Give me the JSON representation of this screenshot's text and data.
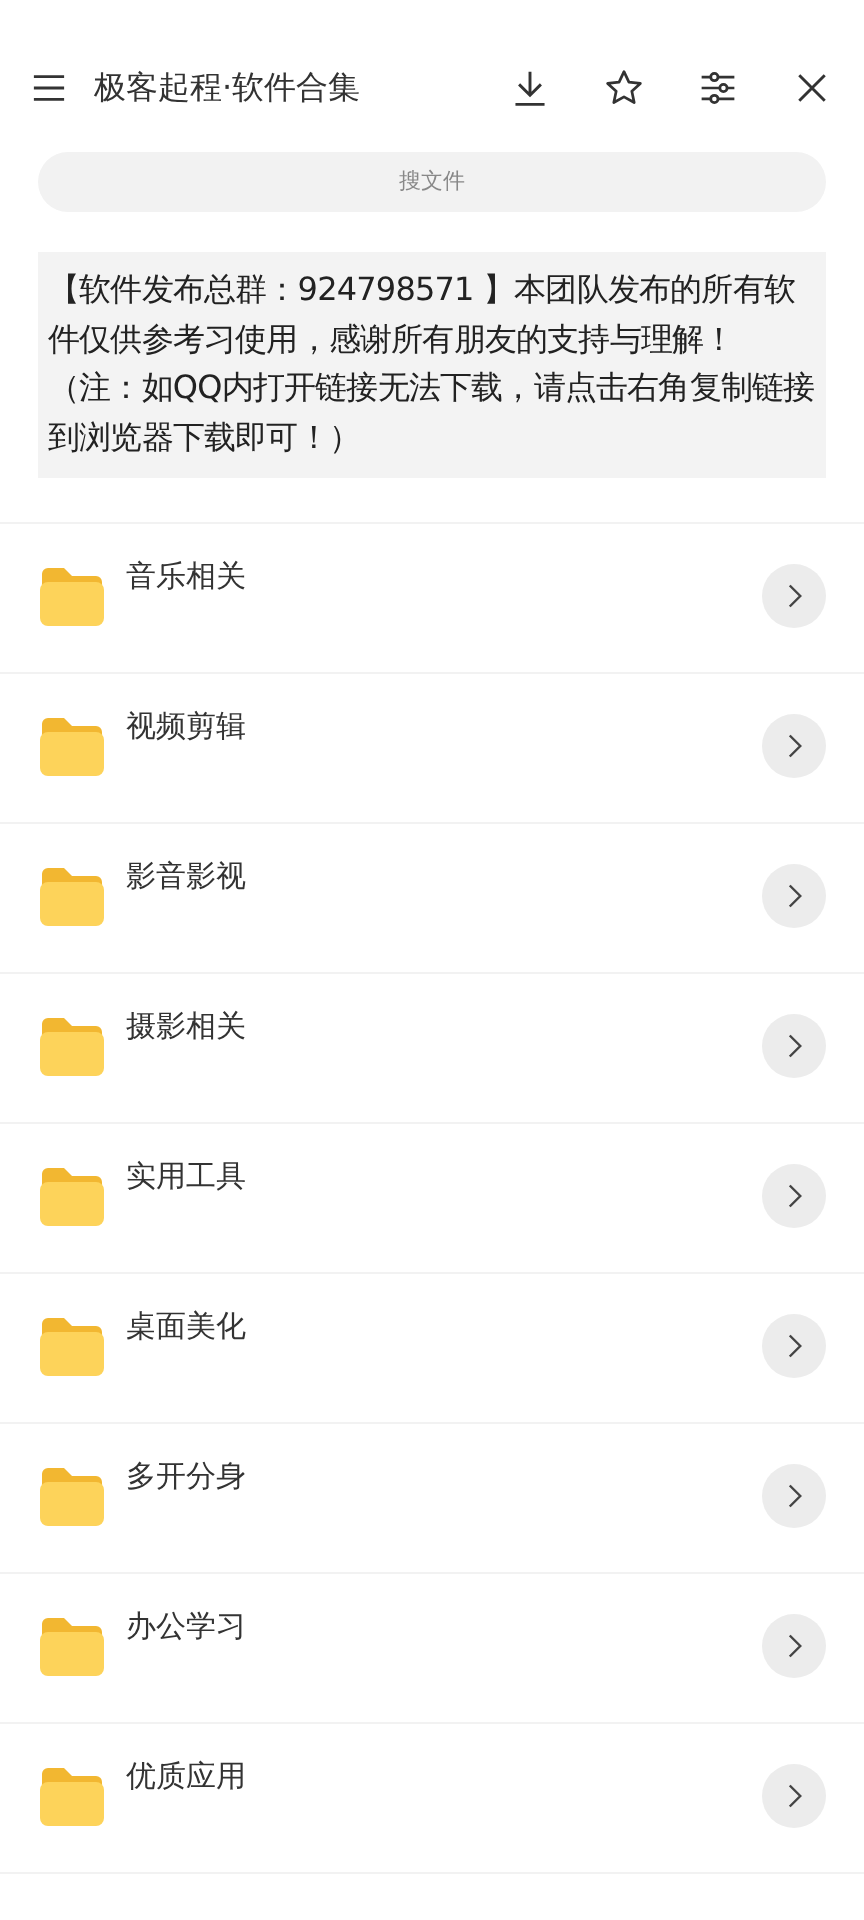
{
  "header": {
    "title": "极客起程·软件合集"
  },
  "search": {
    "placeholder": "搜文件"
  },
  "notice": "【软件发布总群：924798571 】本团队发布的所有软件仅供参考习使用，感谢所有朋友的支持与理解！（注：如QQ内打开链接无法下载，请点击右角复制链接到浏览器下载即可！）",
  "folders": [
    {
      "name": "音乐相关"
    },
    {
      "name": "视频剪辑"
    },
    {
      "name": "影音影视"
    },
    {
      "name": "摄影相关"
    },
    {
      "name": "实用工具"
    },
    {
      "name": "桌面美化"
    },
    {
      "name": "多开分身"
    },
    {
      "name": "办公学习"
    },
    {
      "name": "优质应用"
    }
  ]
}
